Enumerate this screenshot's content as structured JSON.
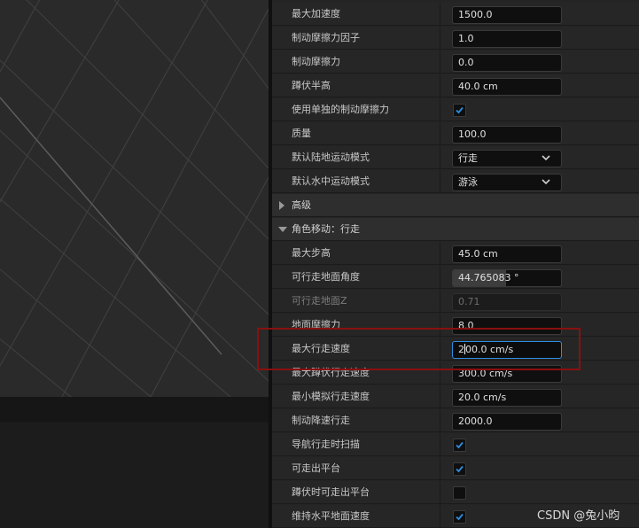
{
  "viewport": {
    "grid_color": "#444444"
  },
  "details": {
    "rows": [
      {
        "label": "最大加速度",
        "kind": "input",
        "value": "1500.0"
      },
      {
        "label": "制动摩擦力因子",
        "kind": "input",
        "value": "1.0"
      },
      {
        "label": "制动摩擦力",
        "kind": "input",
        "value": "0.0"
      },
      {
        "label": "蹲伏半高",
        "kind": "input",
        "value": "40.0 cm"
      },
      {
        "label": "使用单独的制动摩擦力",
        "kind": "checkbox",
        "checked": true
      },
      {
        "label": "质量",
        "kind": "input",
        "value": "100.0"
      },
      {
        "label": "默认陆地运动模式",
        "kind": "dropdown",
        "value": "行走",
        "icon": "chevron-down-icon"
      },
      {
        "label": "默认水中运动模式",
        "kind": "dropdown",
        "value": "游泳",
        "icon": "chevron-down-icon"
      },
      {
        "label": "高级",
        "kind": "section",
        "expanded": false,
        "icon": "triangle-right-icon"
      },
      {
        "label": "角色移动：行走",
        "kind": "section",
        "expanded": true,
        "icon": "triangle-down-icon"
      },
      {
        "label": "最大步高",
        "kind": "input",
        "value": "45.0 cm"
      },
      {
        "label": "可行走地面角度",
        "kind": "slider",
        "value": "44.765083 °",
        "fill_fraction": 0.49
      },
      {
        "label": "可行走地面Z",
        "kind": "input",
        "value": "0.71",
        "disabled": true
      },
      {
        "label": "地面摩擦力",
        "kind": "input",
        "value": "8.0"
      },
      {
        "label": "最大行走速度",
        "kind": "input",
        "value_before_caret": "2",
        "value_after_caret": "00.0 cm/s",
        "active": true
      },
      {
        "label": "最大蹲伏行走速度",
        "kind": "input",
        "value": "300.0 cm/s"
      },
      {
        "label": "最小模拟行走速度",
        "kind": "input",
        "value": "20.0 cm/s"
      },
      {
        "label": "制动降速行走",
        "kind": "input",
        "value": "2000.0"
      },
      {
        "label": "导航行走时扫描",
        "kind": "checkbox",
        "checked": true
      },
      {
        "label": "可走出平台",
        "kind": "checkbox",
        "checked": true
      },
      {
        "label": "蹲伏时可走出平台",
        "kind": "checkbox",
        "checked": false
      },
      {
        "label": "维持水平地面速度",
        "kind": "checkbox",
        "checked": true
      }
    ]
  },
  "highlight": {
    "color": "#8a1010",
    "target_label": "最大行走速度"
  },
  "watermark": "CSDN @兔小昀",
  "colors": {
    "check": "#2f8ee0",
    "active_border": "#2f8ee0"
  }
}
